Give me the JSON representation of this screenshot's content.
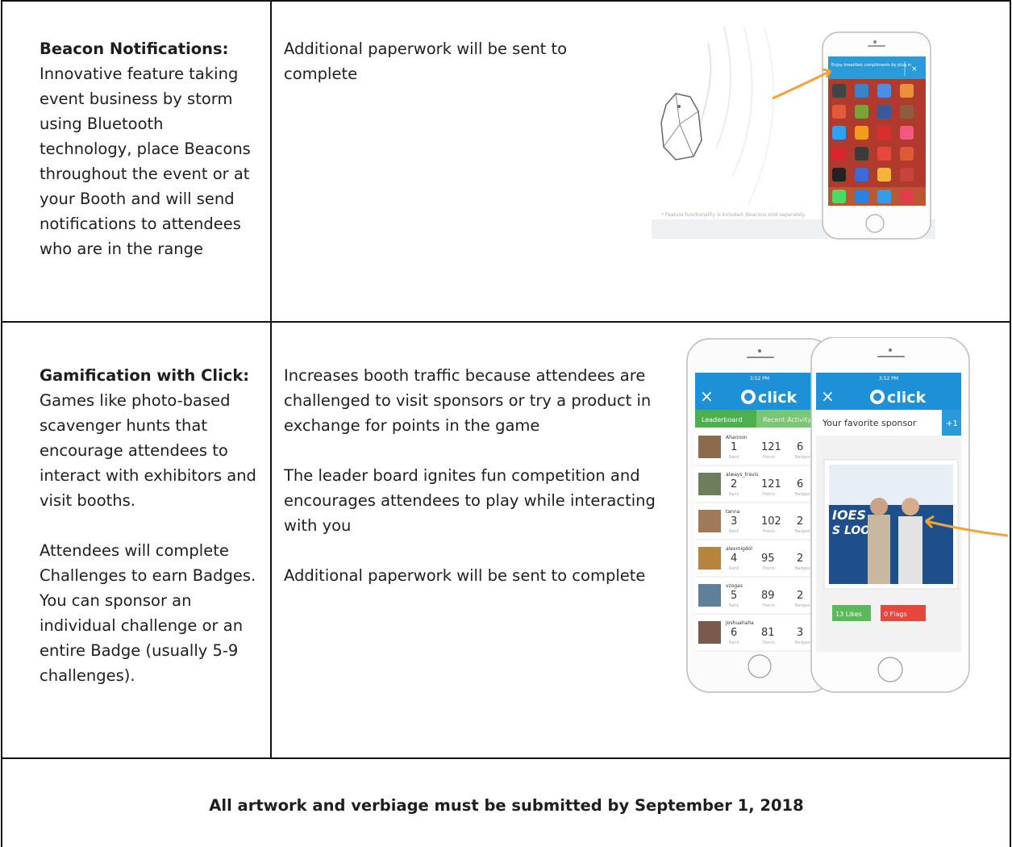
{
  "rows": [
    {
      "feature_title": "Beacon Notifications:",
      "feature_desc": "Innovative feature taking event business by storm using Bluetooth technology, place Beacons throughout the event or at your Booth and will send notifications to attendees who are in the range",
      "details": [
        "Additional paperwork will be sent to complete"
      ],
      "image": {
        "caption": "* Feature functionality is included. Beacons sold separately.",
        "notification_text": "Enjoy breakfast compliments by plug.in"
      }
    },
    {
      "feature_title": "Gamification with Click:",
      "feature_desc": "Games like photo-based scavenger hunts that encourage attendees to interact with exhibitors and visit booths.",
      "feature_desc_2": "Attendees will complete Challenges to earn Badges. You can sponsor an individual challenge or an entire Badge (usually 5-9 challenges).",
      "details": [
        "Increases booth traffic because attendees are challenged to visit sponsors or try a product in exchange for points in the game",
        "The leader board ignites fun competition and encourages attendees to play while interacting with you",
        "Additional paperwork will be sent to complete"
      ],
      "image": {
        "app_name": "click",
        "status_time": "3:52 PM",
        "tabs": [
          "Leaderboard",
          "Recent Activity"
        ],
        "leaderboard": [
          {
            "name": "Ahannon",
            "rank": "1",
            "points": "121",
            "badges": "6"
          },
          {
            "name": "always_travis",
            "rank": "2",
            "points": "121",
            "badges": "6"
          },
          {
            "name": "tanna",
            "rank": "3",
            "points": "102",
            "badges": "2"
          },
          {
            "name": "alexmigdol",
            "rank": "4",
            "points": "95",
            "badges": "2"
          },
          {
            "name": "vzogas",
            "rank": "5",
            "points": "89",
            "badges": "2"
          },
          {
            "name": "Joshuahaha",
            "rank": "6",
            "points": "81",
            "badges": "3"
          }
        ],
        "col_labels": {
          "rank": "Rank",
          "points": "Points",
          "badges": "Badges"
        },
        "sponsor_title": "Your favorite sponsor",
        "plus_one": "+1",
        "likes": "13  Likes",
        "flags": "0  Flags",
        "photo_text_1": "IOES",
        "photo_text_2": "S LOOK L"
      }
    }
  ],
  "footer": "All artwork and verbiage must be submitted by September 1, 2018",
  "colors": {
    "accent_blue": "#1e90d8",
    "accent_green": "#4caf50",
    "arrow_orange": "#f2a33a",
    "flag_red": "#e4473b"
  }
}
